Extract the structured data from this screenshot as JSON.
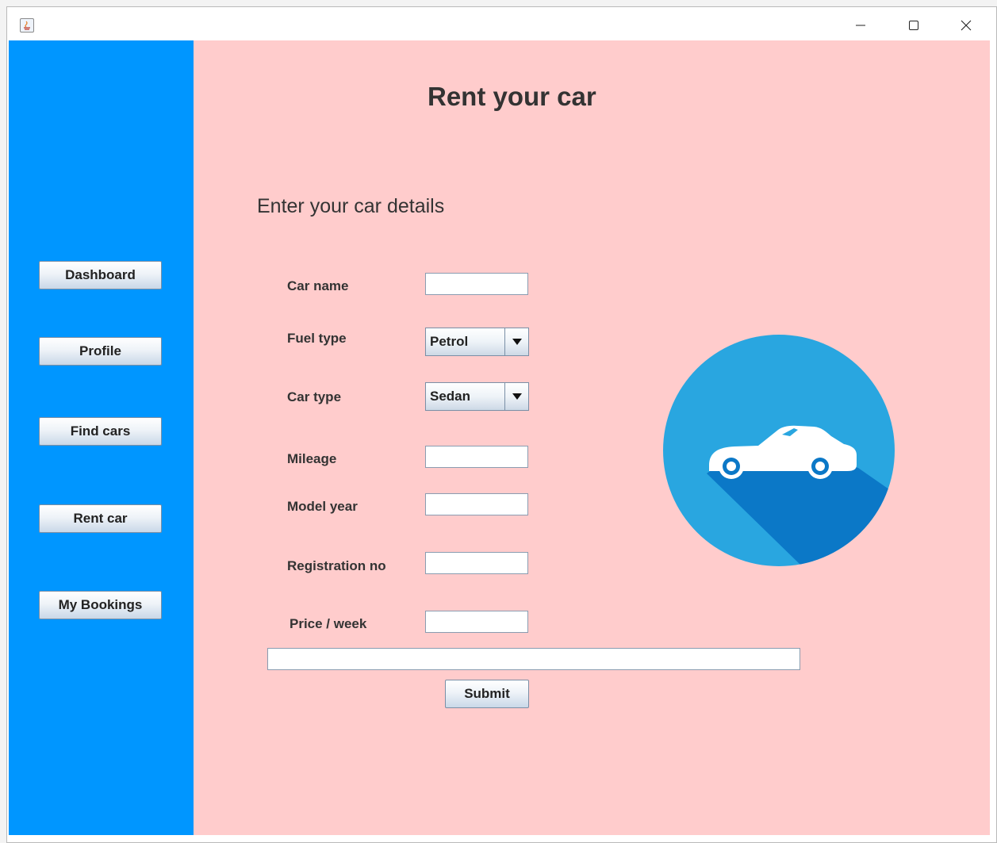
{
  "window": {
    "controls": [
      "minimize",
      "maximize",
      "close"
    ]
  },
  "sidebar": {
    "background": "#0096ff",
    "items": [
      {
        "label": "Dashboard"
      },
      {
        "label": "Profile"
      },
      {
        "label": "Find cars"
      },
      {
        "label": "Rent car"
      },
      {
        "label": "My Bookings"
      }
    ]
  },
  "main": {
    "background": "#ffcccc",
    "title": "Rent your car",
    "section_label": "Enter your car details",
    "form": {
      "car_name": {
        "label": "Car name",
        "value": ""
      },
      "fuel_type": {
        "label": "Fuel type",
        "value": "Petrol"
      },
      "car_type": {
        "label": "Car type",
        "value": "Sedan"
      },
      "mileage": {
        "label": "Mileage",
        "value": ""
      },
      "model_year": {
        "label": "Model year",
        "value": ""
      },
      "registration_no": {
        "label": "Registration no",
        "value": ""
      },
      "price_week": {
        "label": "Price / week",
        "value": ""
      },
      "status_field": {
        "value": ""
      },
      "submit_label": "Submit"
    },
    "illustration": {
      "icon": "car-icon",
      "circle_color": "#29a6e0",
      "shadow_color": "#0b78c7"
    }
  }
}
